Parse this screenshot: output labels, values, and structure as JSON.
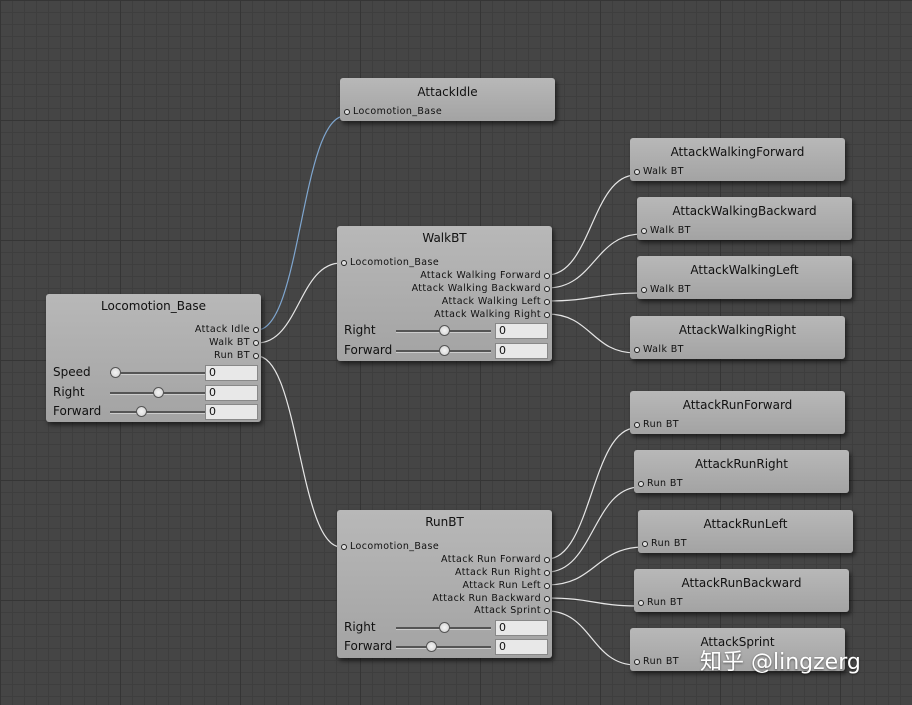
{
  "locomotion_base": {
    "title": "Locomotion_Base",
    "outputs": [
      "Attack Idle",
      "Walk BT",
      "Run BT"
    ],
    "params": [
      {
        "label": "Speed",
        "value": "0",
        "level": 0.0
      },
      {
        "label": "Right",
        "value": "0",
        "level": 0.5
      },
      {
        "label": "Forward",
        "value": "0",
        "level": 0.3
      }
    ]
  },
  "attack_idle": {
    "title": "AttackIdle",
    "input": "Locomotion_Base"
  },
  "walk_bt": {
    "title": "WalkBT",
    "input": "Locomotion_Base",
    "outputs": [
      "Attack Walking Forward",
      "Attack Walking Backward",
      "Attack Walking Left",
      "Attack Walking Right"
    ],
    "params": [
      {
        "label": "Right",
        "value": "0",
        "level": 0.5
      },
      {
        "label": "Forward",
        "value": "0",
        "level": 0.5
      }
    ]
  },
  "run_bt": {
    "title": "RunBT",
    "input": "Locomotion_Base",
    "outputs": [
      "Attack Run Forward",
      "Attack Run Right",
      "Attack Run Left",
      "Attack Run Backward",
      "Attack Sprint"
    ],
    "params": [
      {
        "label": "Right",
        "value": "0",
        "level": 0.5
      },
      {
        "label": "Forward",
        "value": "0",
        "level": 0.35
      }
    ]
  },
  "walk_leaves": [
    {
      "title": "AttackWalkingForward",
      "input": "Walk BT"
    },
    {
      "title": "AttackWalkingBackward",
      "input": "Walk BT"
    },
    {
      "title": "AttackWalkingLeft",
      "input": "Walk BT"
    },
    {
      "title": "AttackWalkingRight",
      "input": "Walk BT"
    }
  ],
  "run_leaves": [
    {
      "title": "AttackRunForward",
      "input": "Run BT"
    },
    {
      "title": "AttackRunRight",
      "input": "Run BT"
    },
    {
      "title": "AttackRunLeft",
      "input": "Run BT"
    },
    {
      "title": "AttackRunBackward",
      "input": "Run BT"
    },
    {
      "title": "AttackSprint",
      "input": "Run BT"
    }
  ],
  "watermark": "知乎 @lingzerg",
  "colors": {
    "selected_wire": "#7fa6cf",
    "wire": "#e6e6e6",
    "grid_bg": "#454545"
  }
}
